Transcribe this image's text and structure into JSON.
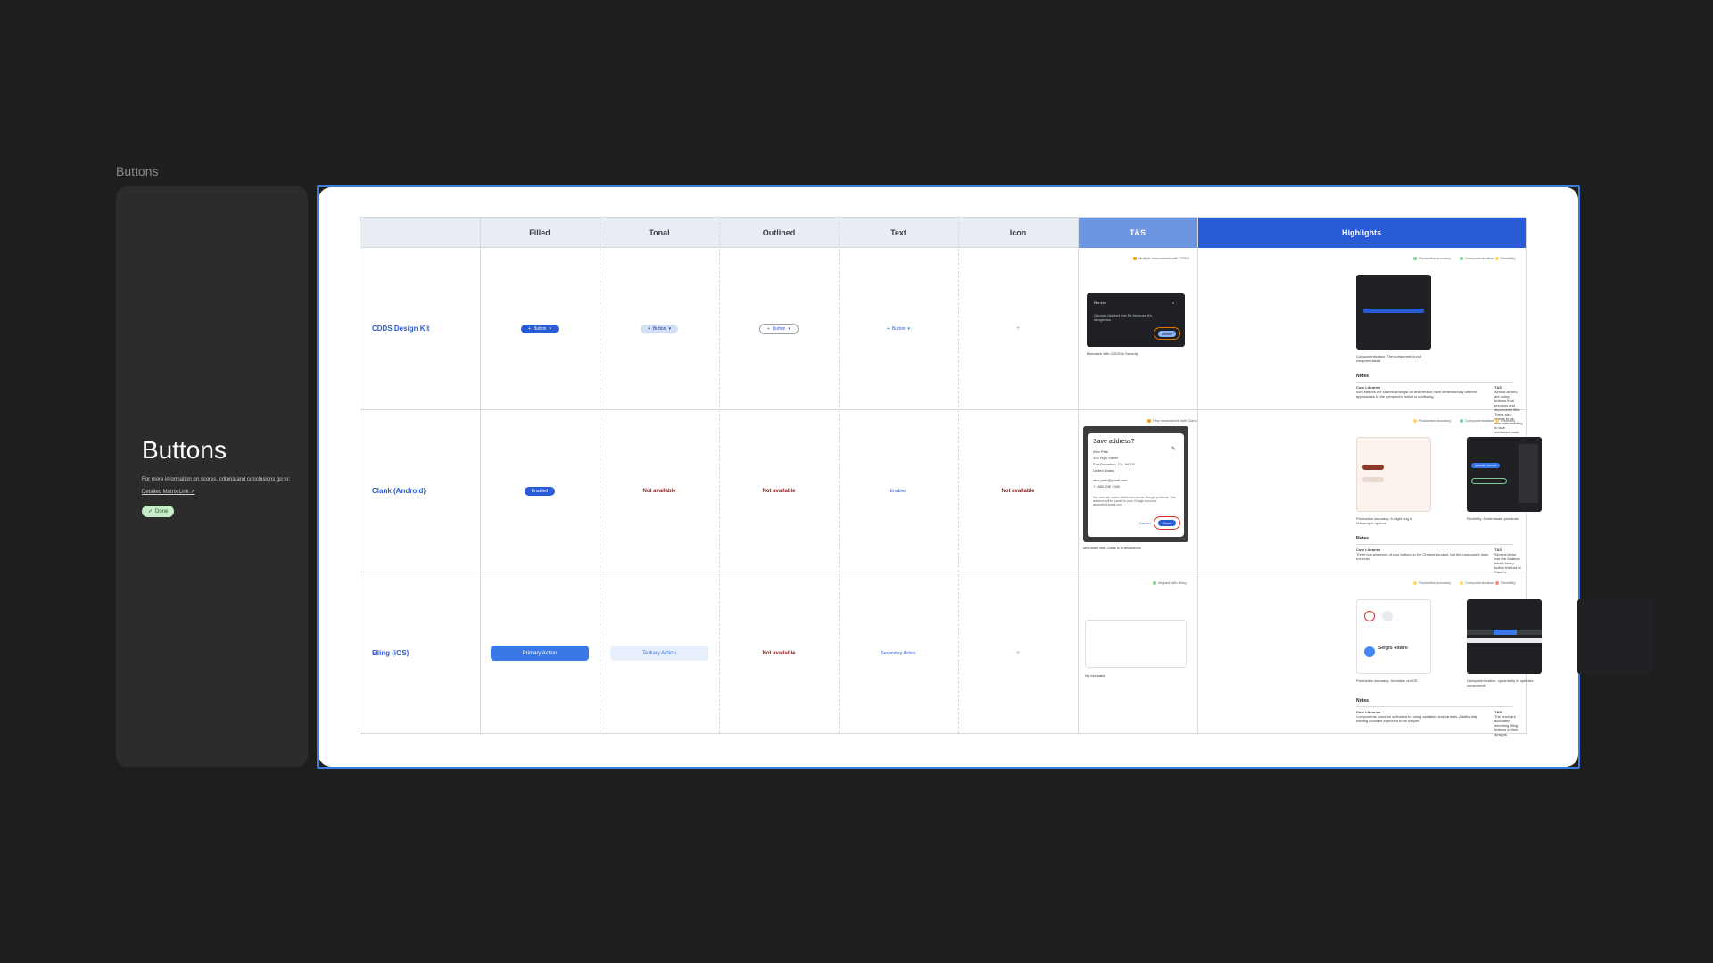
{
  "frame_label": "Buttons",
  "side": {
    "title": "Buttons",
    "info": "For more information on scores, criteria and conclusions go to:",
    "link": "Detailed Matrix Link ↗",
    "status": "Done"
  },
  "table": {
    "headers": [
      "Filled",
      "Tonal",
      "Outlined",
      "Text",
      "Icon",
      "T&S",
      "Highlights"
    ],
    "row_labels": [
      "CDDS Design Kit",
      "Clank (Android)",
      "Bling (iOS)"
    ],
    "rows": [
      {
        "filled": "Button",
        "tonal": "Button",
        "outlined": "Button",
        "text": "Button",
        "icon": "+",
        "ts_tag": "Multiple mismatches with CDDS",
        "ts_dialog_title": "File.exe",
        "ts_dialog_text": "Chrome blocked this file because it's dangerous",
        "ts_dialog_btn": "Delete",
        "ts_caption": "Mismatch with CDDS in Security",
        "hl_tags": [
          "Production accuracy",
          "Componentization",
          "Flexibility"
        ],
        "hl_caption": "Componentization: The component is not componentized",
        "notes_label": "Notes",
        "notes_left_title": "Core Libraries",
        "notes_left": "Icon buttons are shared amongst all libraries but have dimensionally different approaches to the component which is confusing.",
        "notes_right_title": "T&S",
        "notes_right": "Almost all files are using buttons from previous and deprecated files. There also seems to be misunderstanding to take contained mark."
      },
      {
        "filled": "Enabled",
        "tonal": "Not available",
        "outlined": "Not available",
        "text": "Enabled",
        "icon": "Not available",
        "ts_tag": "Few mismatches with Clank",
        "ts_dialog_title": "Save address?",
        "ts_dialog_lines": [
          "Alex Park",
          "345 High Street",
          "San Francisco, CA, 94105",
          "United States",
          "",
          "alex.park@gmail.com",
          "+1 650 230 4000"
        ],
        "ts_dialog_footer": "You can use saved addresses across Google products. This address will be saved in your Google Account, alexpark@gmail.com",
        "ts_cancel": "Cancel",
        "ts_save": "Save",
        "ts_caption": "Mismatch with Clank in Transactions",
        "hl_tags": [
          "Production accuracy",
          "Componentization",
          "Flexibility"
        ],
        "hl_captions": [
          "Production accuracy: A slight bug in Messenger options",
          "Flexibility: Determinate problems"
        ],
        "hl_thumb_label": "Proceed / Refresh",
        "notes_label": "Notes",
        "notes_left_title": "Core Libraries",
        "notes_left": "There is a presence of icon buttons in the Chrome product, but the component does not exist.",
        "notes_right_title": "T&S",
        "notes_right": "Several items use the Material Next Library button instead of Clank's."
      },
      {
        "filled": "Primary Action",
        "tonal": "Tertiary Action",
        "outlined": "Not available",
        "text": "Secondary Action",
        "icon": "+",
        "ts_tag": "Aligned with Bling",
        "ts_caption": "No mismatch",
        "hl_tags": [
          "Production accuracy",
          "Componentization",
          "Flexibility"
        ],
        "hl_captions": [
          "Production accuracy: Deviation on iOS",
          "Componentization: opportunity to optimize components",
          "Flexibility: Components are hard to customize and can only be alternated between Light/Dark mode."
        ],
        "hl_profile_name": "Sergio Ribero",
        "hl_primary": "Primary",
        "hl_colour_mode": "Colour Mode",
        "hl_light": "Light",
        "notes_label": "Notes",
        "notes_left_title": "Core Libraries",
        "notes_left": "Components could be optimized by using variables and variants. Additionally, naming could be improved to be simpler.",
        "notes_right_title": "T&S",
        "notes_right": "The team are accurately inheriting Bling buttons in their designs."
      }
    ]
  },
  "colors": {
    "accent": "#2a5bd7",
    "ts_header": "#6e95e0",
    "not_available": "#8b1a1a",
    "done_badge": "#c6ecc8"
  }
}
